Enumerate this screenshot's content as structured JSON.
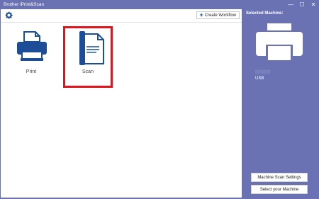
{
  "app": {
    "title": "Brother iPrint&Scan"
  },
  "window_controls": {
    "minimize": "—",
    "maximize": "☐",
    "close": "✕"
  },
  "toolbar": {
    "settings_icon": "gear-icon",
    "create_workflow": "Create Workflow"
  },
  "tiles": [
    {
      "label": "Print",
      "icon": "printer-icon",
      "selected": false
    },
    {
      "label": "Scan",
      "icon": "scan-document-icon",
      "selected": true
    }
  ],
  "sidebar": {
    "selected_machine_label": "Selected Machine:",
    "machine_icon": "printer-icon",
    "connection": "USB",
    "buttons": {
      "machine_scan_settings": "Machine Scan Settings",
      "select_machine": "Select your Machine"
    }
  },
  "colors": {
    "accent": "#6a72b4",
    "icon_blue": "#1c4d96",
    "selection_red": "#e1141b"
  }
}
